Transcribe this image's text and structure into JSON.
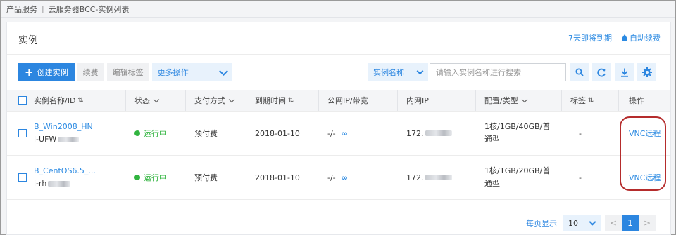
{
  "breadcrumb": [
    "产品服务",
    "云服务器BCC-实例列表"
  ],
  "page_title": "实例",
  "top_links": {
    "expiring": "7天即将到期",
    "auto_renew": "自动续费"
  },
  "toolbar": {
    "create": "创建实例",
    "renew": "续费",
    "edit_tags": "编辑标签",
    "more": "更多操作"
  },
  "search": {
    "field_select": "实例名称",
    "placeholder": "请输入实例名称进行搜索"
  },
  "icons": [
    "search-icon",
    "refresh-icon",
    "download-icon",
    "settings-icon"
  ],
  "table": {
    "headers": [
      "实例名称/ID",
      "状态",
      "支付方式",
      "到期时间",
      "公网IP/带宽",
      "内网IP",
      "配置/类型",
      "标签",
      "操作"
    ],
    "rows": [
      {
        "name": "B_Win2008_HN",
        "id": "i-UFW",
        "status": "运行中",
        "pay": "预付费",
        "expire": "2018-01-10",
        "public_ip": "-/-",
        "private_ip": "172.",
        "config_line1": "1核/1GB/40GB/普",
        "config_line2": "通型",
        "tags": "-",
        "action": "VNC远程"
      },
      {
        "name": "B_CentOS6.5_...",
        "id": "i-rh",
        "status": "运行中",
        "pay": "预付费",
        "expire": "2018-01-10",
        "public_ip": "-/-",
        "private_ip": "172.",
        "config_line1": "1核/1GB/20GB/普",
        "config_line2": "通型",
        "tags": "-",
        "action": "VNC远程"
      }
    ]
  },
  "pagination": {
    "label": "每页显示",
    "page_size": "10",
    "prev": "<",
    "current": "1",
    "next": ">"
  },
  "colors": {
    "accent": "#2c86e0",
    "running": "#31b43f",
    "callout": "#b52c2c"
  }
}
